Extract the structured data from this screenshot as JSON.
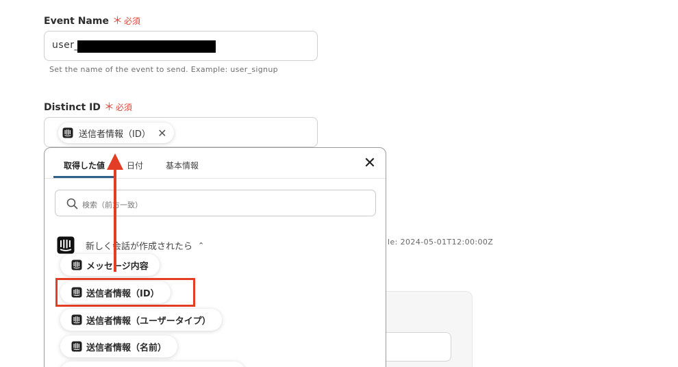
{
  "event_name": {
    "label": "Event Name",
    "required_mark": "＊",
    "required_text": "必須",
    "value": "user_",
    "hint": "Set the name of the event to send. Example: user_signup"
  },
  "distinct_id": {
    "label": "Distinct ID",
    "required_mark": "＊",
    "required_text": "必須",
    "chip_label": "送信者情報（ID）",
    "chip_close": "✕"
  },
  "background": {
    "example_text": "le: 2024-05-01T12:00:00Z"
  },
  "picker": {
    "tabs": [
      "取得した値",
      "日付",
      "基本情報"
    ],
    "active_tab_index": 0,
    "close_symbol": "✕",
    "search_placeholder": "検索（前方一致）",
    "trigger": {
      "label": "新しく会話が作成されたら",
      "chevron": "⌃"
    },
    "items": [
      "メッセージ内容",
      "送信者情報（ID）",
      "送信者情報（ユーザータイプ）",
      "送信者情報（名前）"
    ],
    "highlighted_item_index": 1
  },
  "colors": {
    "accent_red": "#e43d26",
    "tab_underline": "#2e6189",
    "required": "#e0453a"
  },
  "icons": {
    "chip_icon": "intercom-icon",
    "trigger_icon": "intercom-logo-icon",
    "search_icon": "search-icon",
    "close_icon": "close-icon"
  }
}
